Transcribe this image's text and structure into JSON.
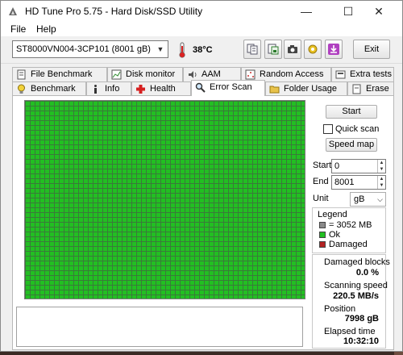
{
  "window": {
    "title": "HD Tune Pro 5.75 - Hard Disk/SSD Utility",
    "controls": {
      "minimize": "—",
      "maximize": "☐",
      "close": "✕"
    }
  },
  "menu": [
    {
      "label": "File",
      "accel": "F"
    },
    {
      "label": "Help",
      "accel": "H"
    }
  ],
  "toolbar": {
    "drive": "ST8000VN004-3CP101 (8001 gB)",
    "temperature": "38°C",
    "buttons": [
      "copy-info-icon",
      "save-icon",
      "screenshot-icon",
      "settings-icon",
      "download-icon"
    ],
    "exit_label": "Exit"
  },
  "tabs": {
    "row1": [
      {
        "label": "File Benchmark",
        "icon": "file-benchmark-icon"
      },
      {
        "label": "Disk monitor",
        "icon": "disk-monitor-icon"
      },
      {
        "label": "AAM",
        "icon": "speaker-icon"
      },
      {
        "label": "Random Access",
        "icon": "random-access-icon"
      },
      {
        "label": "Extra tests",
        "icon": "extra-tests-icon"
      }
    ],
    "row2": [
      {
        "label": "Benchmark",
        "icon": "lightbulb-icon"
      },
      {
        "label": "Info",
        "icon": "info-icon"
      },
      {
        "label": "Health",
        "icon": "health-cross-icon"
      },
      {
        "label": "Error Scan",
        "icon": "magnifier-icon",
        "active": true
      },
      {
        "label": "Folder Usage",
        "icon": "folder-icon"
      },
      {
        "label": "Erase",
        "icon": "erase-icon"
      }
    ]
  },
  "scan": {
    "start_button": "Start",
    "quick_scan_label": "Quick scan",
    "quick_scan_checked": false,
    "speed_map_button": "Speed map",
    "start_label": "Start",
    "start_value": "0",
    "end_label": "End",
    "end_value": "8001",
    "unit_label": "Unit",
    "unit_value": "gB"
  },
  "legend": {
    "title": "Legend",
    "items": [
      {
        "label": "= 3052 MB",
        "color": "#8a8a8a"
      },
      {
        "label": "Ok",
        "color": "#22bf22"
      },
      {
        "label": "Damaged",
        "color": "#b22222"
      }
    ]
  },
  "stats": {
    "damaged_label": "Damaged blocks",
    "damaged_value": "0.0 %",
    "speed_label": "Scanning speed",
    "speed_value": "220.5 MB/s",
    "position_label": "Position",
    "position_value": "7998 gB",
    "elapsed_label": "Elapsed time",
    "elapsed_value": "10:32:10"
  },
  "colors": {
    "block_ok": "#22bf22",
    "block_damaged": "#b22222",
    "block_pending": "#8a8a8a"
  },
  "scan_map": {
    "completed_fraction": 1.0
  }
}
